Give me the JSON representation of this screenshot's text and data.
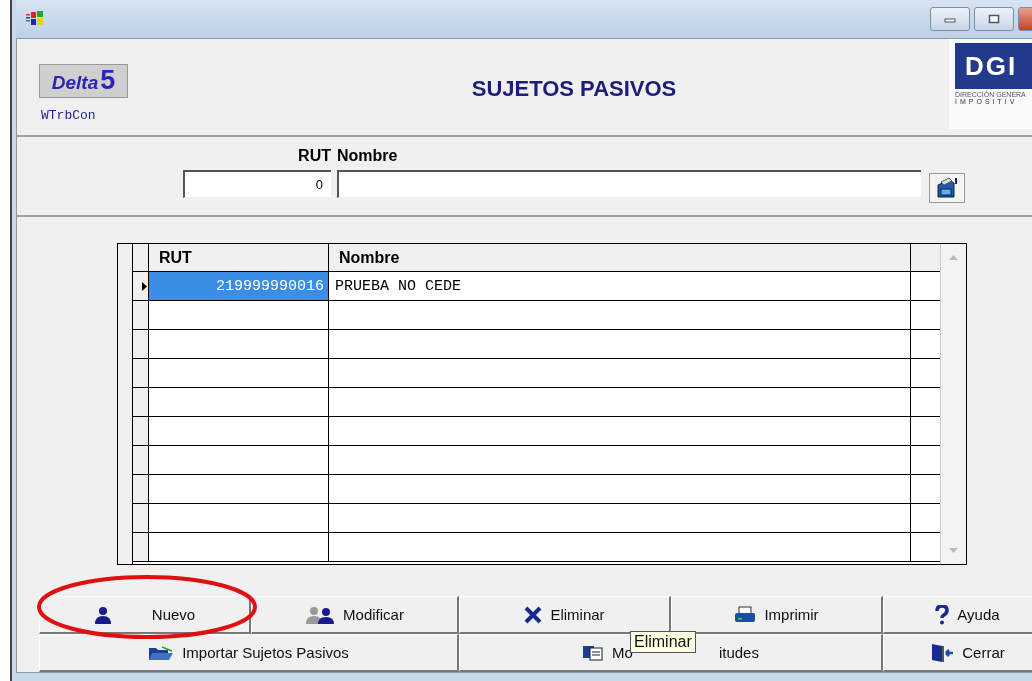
{
  "header": {
    "app_logo": {
      "word": "Delta",
      "number": "5"
    },
    "form_code": "WTrbCon",
    "title": "SUJETOS PASIVOS",
    "org_logo": {
      "mark": "DGI",
      "line_1": "DIRECCIÓN GENERA",
      "line_2": "IMPOSITIV"
    }
  },
  "filter": {
    "rut_label": "RUT",
    "rut_value": "0",
    "nombre_label": "Nombre"
  },
  "table": {
    "columns": [
      "RUT",
      "Nombre"
    ],
    "rows": [
      {
        "rut": "219999990016",
        "nombre": "PRUEBA NO CEDE",
        "selected": true
      }
    ]
  },
  "buttons": [
    {
      "label": "Nuevo"
    },
    {
      "label": "Modificar"
    },
    {
      "label": "Eliminar"
    },
    {
      "label": "Imprimir"
    },
    {
      "label": "Ayuda"
    },
    {
      "label": "Importar Sujetos Pasivos"
    },
    {
      "label": "Mo",
      "label_after_tooltip": "itudes",
      "tooltip": "Eliminar"
    },
    {
      "label": "Cerrar"
    }
  ]
}
